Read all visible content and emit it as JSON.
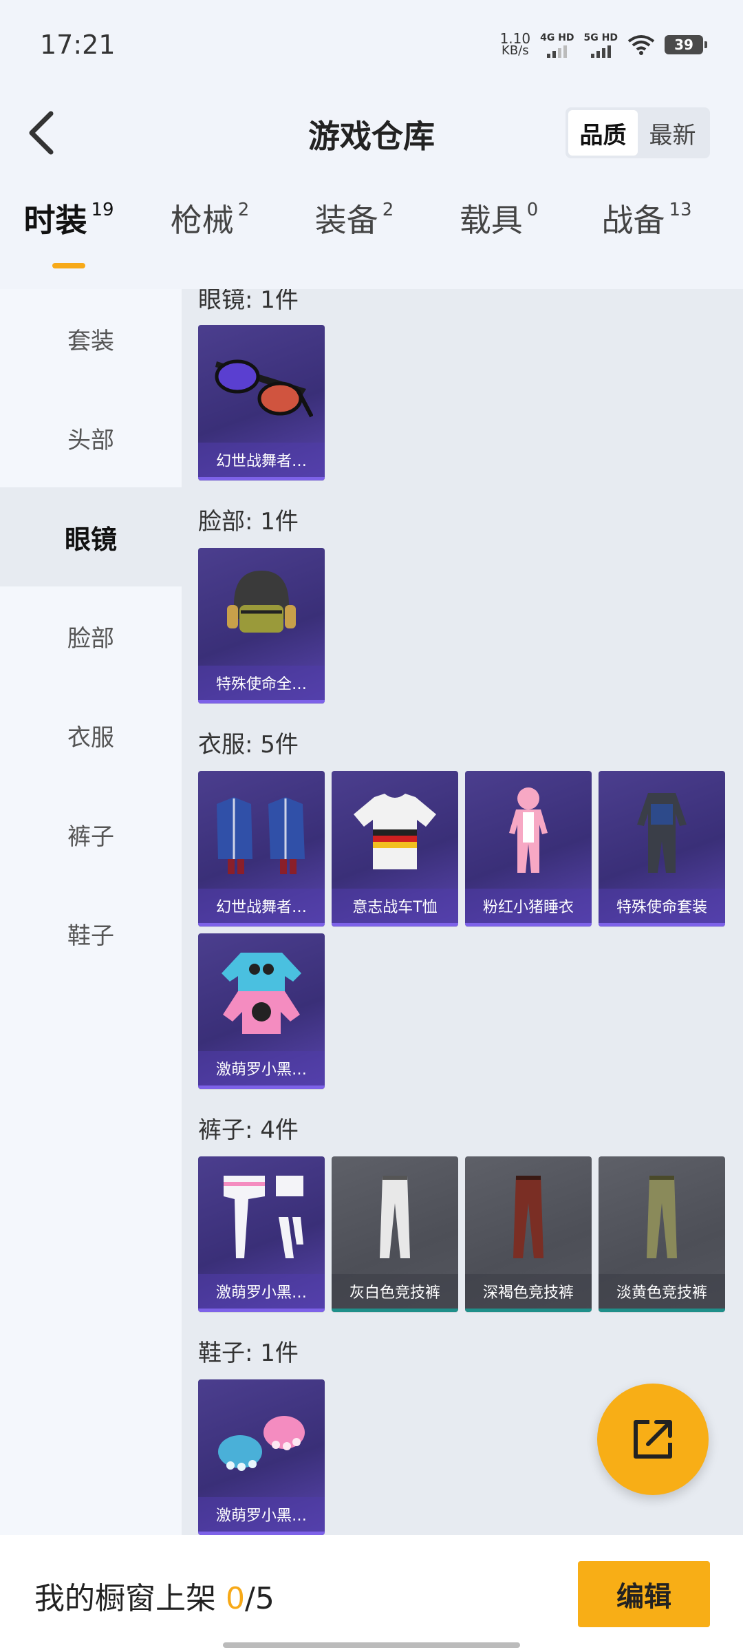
{
  "status_bar": {
    "time": "17:21",
    "net_speed_value": "1.10",
    "net_speed_unit": "KB/s",
    "sim1_label": "4G HD",
    "sim2_label": "5G HD",
    "battery": "39"
  },
  "header": {
    "title": "游戏仓库",
    "sort_options": [
      "品质",
      "最新"
    ],
    "sort_selected": "品质"
  },
  "tabs": [
    {
      "label": "时装",
      "count": "19",
      "active": true
    },
    {
      "label": "枪械",
      "count": "2",
      "active": false
    },
    {
      "label": "装备",
      "count": "2",
      "active": false
    },
    {
      "label": "载具",
      "count": "0",
      "active": false
    },
    {
      "label": "战备",
      "count": "13",
      "active": false
    }
  ],
  "sidebar": {
    "items": [
      {
        "label": "套装"
      },
      {
        "label": "头部"
      },
      {
        "label": "眼镜"
      },
      {
        "label": "脸部"
      },
      {
        "label": "衣服"
      },
      {
        "label": "裤子"
      },
      {
        "label": "鞋子"
      }
    ],
    "active": "眼镜"
  },
  "sections": [
    {
      "title": "眼镜: 1件",
      "items": [
        {
          "name": "幻世战舞者…",
          "style": "purple",
          "icon": "sunglasses-icon"
        }
      ]
    },
    {
      "title": "脸部: 1件",
      "items": [
        {
          "name": "特殊使命全…",
          "style": "purple",
          "icon": "helmet-icon"
        }
      ]
    },
    {
      "title": "衣服: 5件",
      "items": [
        {
          "name": "幻世战舞者…",
          "style": "purple",
          "icon": "coat-icon"
        },
        {
          "name": "意志战车T恤",
          "style": "purple",
          "icon": "tshirt-icon"
        },
        {
          "name": "粉红小猪睡衣",
          "style": "purple",
          "icon": "pajamas-icon"
        },
        {
          "name": "特殊使命套装",
          "style": "purple",
          "icon": "suit-icon"
        },
        {
          "name": "激萌罗小黑…",
          "style": "purple",
          "icon": "hoodie-icon"
        }
      ]
    },
    {
      "title": "裤子: 4件",
      "items": [
        {
          "name": "激萌罗小黑…",
          "style": "purple",
          "icon": "stockings-icon"
        },
        {
          "name": "灰白色竞技裤",
          "style": "gray",
          "icon": "pants-icon"
        },
        {
          "name": "深褐色竞技裤",
          "style": "gray",
          "icon": "pants-icon"
        },
        {
          "name": "淡黄色竞技裤",
          "style": "gray",
          "icon": "pants-icon"
        }
      ]
    },
    {
      "title": "鞋子: 1件",
      "items": [
        {
          "name": "激萌罗小黑…",
          "style": "purple",
          "icon": "paw-shoes-icon"
        }
      ]
    }
  ],
  "bottom_bar": {
    "showcase_label": "我的橱窗上架",
    "showcase_count": "0",
    "showcase_sep": "/",
    "showcase_total": "5",
    "edit_label": "编辑"
  },
  "colors": {
    "accent": "#f8ae16",
    "card_purple": "#3a2f78",
    "card_gray": "#4d4f57"
  }
}
